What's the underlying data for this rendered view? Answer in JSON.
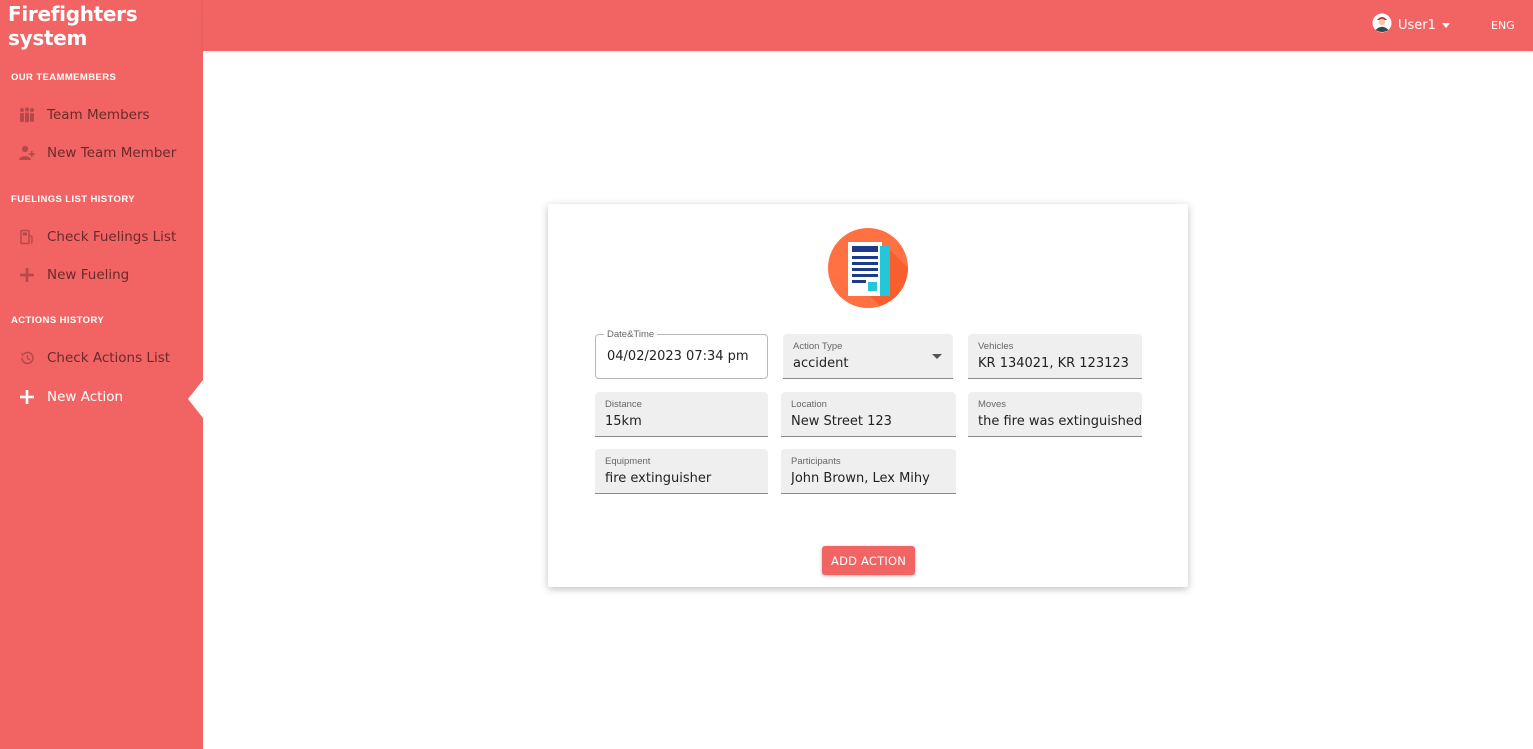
{
  "app": {
    "title": "Firefighters system"
  },
  "header": {
    "user_label": "User1",
    "language": "ENG"
  },
  "sidebar": {
    "sections": [
      {
        "title": "OUR TEAMMEMBERS"
      },
      {
        "title": "FUELINGS LIST HISTORY"
      },
      {
        "title": "ACTIONS HISTORY"
      }
    ],
    "items": [
      {
        "label": "Team Members",
        "icon": "team-icon"
      },
      {
        "label": "New Team Member",
        "icon": "add-user-icon"
      },
      {
        "label": "Check Fuelings List",
        "icon": "fuel-icon"
      },
      {
        "label": "New Fueling",
        "icon": "plus-icon"
      },
      {
        "label": "Check Actions List",
        "icon": "history-icon"
      },
      {
        "label": "New Action",
        "icon": "plus-icon",
        "active": true
      }
    ]
  },
  "form": {
    "icon": "document-icon",
    "fields": {
      "datetime": {
        "label": "Date&Time",
        "value": "04/02/2023 07:34 pm"
      },
      "action_type": {
        "label": "Action Type",
        "value": "accident"
      },
      "vehicles": {
        "label": "Vehicles",
        "value": "KR 134021, KR 123123"
      },
      "distance": {
        "label": "Distance",
        "value": "15km"
      },
      "location": {
        "label": "Location",
        "value": "New Street 123"
      },
      "moves": {
        "label": "Moves",
        "value": "the fire was extinguished and"
      },
      "equipment": {
        "label": "Equipment",
        "value": "fire extinguisher"
      },
      "participants": {
        "label": "Participants",
        "value": "John Brown, Lex Mihy"
      }
    },
    "submit_label": "ADD ACTION"
  },
  "colors": {
    "brand": "#f26464",
    "icon_orange": "#ff7043",
    "icon_teal": "#26c6da",
    "icon_navy": "#1e3a8a"
  }
}
